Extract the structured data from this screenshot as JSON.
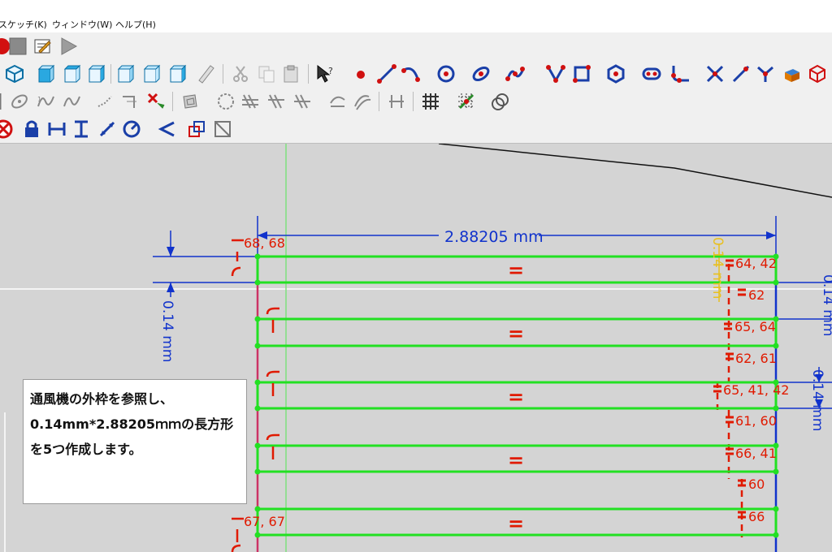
{
  "menu": {
    "sketch": "スケッチ(K)",
    "window": "ウィンドウ(W)",
    "help": "ヘルプ(H)"
  },
  "sketch": {
    "width_dimension": "2.88205 mm",
    "height_dimension": "0.14 mm",
    "height_dimension_right_top": "0.14 mm",
    "height_dimension_right_mid": "0.14 mm",
    "equal_symbol": "=",
    "constraint_labels": [
      "68, 68",
      "64, 42",
      "62",
      "65, 64",
      "62, 61",
      "65, 41, 42",
      "61, 60",
      "66, 41",
      "60",
      "66",
      "67, 67"
    ]
  },
  "note": {
    "text": "通風機の外枠を参照し、0.14mm*2.88205ｍｍの長方形を5つ作成します。"
  },
  "colors": {
    "geometry": "#22e022",
    "dimension": "#1133cc",
    "constraint": "#e01a00",
    "reference_line": "#cc3366"
  }
}
